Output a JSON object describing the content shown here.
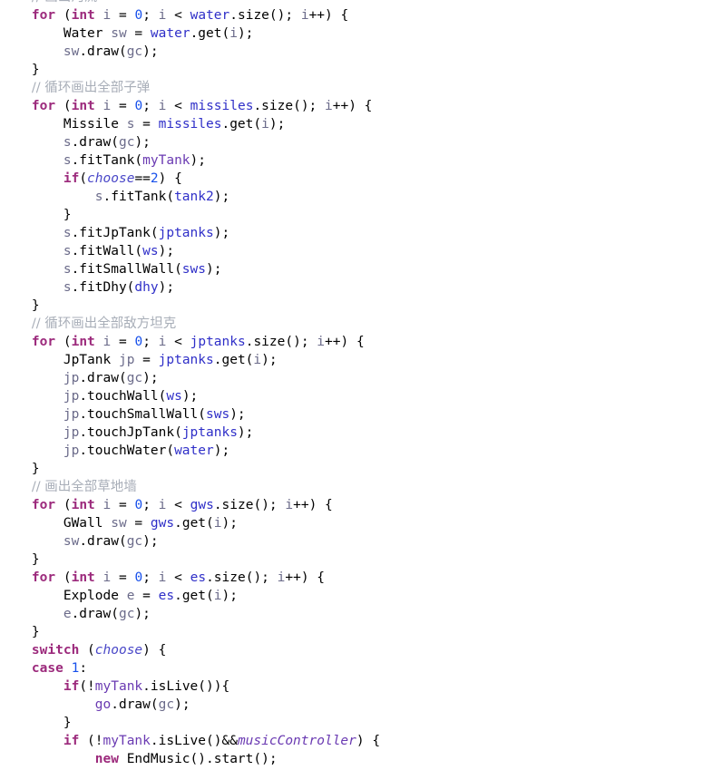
{
  "editor": {
    "language": "java",
    "background": "#ffffff",
    "font_size_px": 14.5,
    "line_height_px": 20,
    "gutter_visible": false,
    "first_line_clipped": true
  },
  "theme": {
    "default_text": "#000000",
    "keyword": "#9c2a7c",
    "comment": "#a8aeb8",
    "number": "#1750eb",
    "field": "#6a3ab2",
    "static_field": "#4a48c8",
    "reference": "#2f2fc8",
    "local_variable": "#6b6b8a",
    "background": "#ffffff"
  },
  "code": {
    "lines": [
      {
        "indent": "    ",
        "tokens": [
          {
            "t": "// 画出河流",
            "c": "comment",
            "cjk": true
          }
        ]
      },
      {
        "indent": "    ",
        "tokens": [
          {
            "t": "for",
            "c": "keyword"
          },
          {
            "t": " (",
            "c": "punc"
          },
          {
            "t": "int",
            "c": "keyword"
          },
          {
            "t": " ",
            "c": "plain"
          },
          {
            "t": "i",
            "c": "local"
          },
          {
            "t": " = ",
            "c": "punc"
          },
          {
            "t": "0",
            "c": "num"
          },
          {
            "t": "; ",
            "c": "punc"
          },
          {
            "t": "i",
            "c": "local"
          },
          {
            "t": " < ",
            "c": "punc"
          },
          {
            "t": "water",
            "c": "ref"
          },
          {
            "t": ".size(); ",
            "c": "punc"
          },
          {
            "t": "i",
            "c": "local"
          },
          {
            "t": "++) {",
            "c": "punc"
          }
        ]
      },
      {
        "indent": "        ",
        "tokens": [
          {
            "t": "Water",
            "c": "type"
          },
          {
            "t": " ",
            "c": "plain"
          },
          {
            "t": "sw",
            "c": "local"
          },
          {
            "t": " = ",
            "c": "punc"
          },
          {
            "t": "water",
            "c": "ref"
          },
          {
            "t": ".get(",
            "c": "punc"
          },
          {
            "t": "i",
            "c": "local"
          },
          {
            "t": ");",
            "c": "punc"
          }
        ]
      },
      {
        "indent": "        ",
        "tokens": [
          {
            "t": "sw",
            "c": "local"
          },
          {
            "t": ".draw(",
            "c": "punc"
          },
          {
            "t": "gc",
            "c": "local"
          },
          {
            "t": ");",
            "c": "punc"
          }
        ]
      },
      {
        "indent": "    ",
        "tokens": [
          {
            "t": "}",
            "c": "punc"
          }
        ]
      },
      {
        "indent": "    ",
        "tokens": [
          {
            "t": "// 循环画出全部子弹",
            "c": "comment",
            "cjk": true
          }
        ]
      },
      {
        "indent": "    ",
        "tokens": [
          {
            "t": "for",
            "c": "keyword"
          },
          {
            "t": " (",
            "c": "punc"
          },
          {
            "t": "int",
            "c": "keyword"
          },
          {
            "t": " ",
            "c": "plain"
          },
          {
            "t": "i",
            "c": "local"
          },
          {
            "t": " = ",
            "c": "punc"
          },
          {
            "t": "0",
            "c": "num"
          },
          {
            "t": "; ",
            "c": "punc"
          },
          {
            "t": "i",
            "c": "local"
          },
          {
            "t": " < ",
            "c": "punc"
          },
          {
            "t": "missiles",
            "c": "ref"
          },
          {
            "t": ".size(); ",
            "c": "punc"
          },
          {
            "t": "i",
            "c": "local"
          },
          {
            "t": "++) {",
            "c": "punc"
          }
        ]
      },
      {
        "indent": "        ",
        "tokens": [
          {
            "t": "Missile",
            "c": "type"
          },
          {
            "t": " ",
            "c": "plain"
          },
          {
            "t": "s",
            "c": "local"
          },
          {
            "t": " = ",
            "c": "punc"
          },
          {
            "t": "missiles",
            "c": "ref"
          },
          {
            "t": ".get(",
            "c": "punc"
          },
          {
            "t": "i",
            "c": "local"
          },
          {
            "t": ");",
            "c": "punc"
          }
        ]
      },
      {
        "indent": "        ",
        "tokens": [
          {
            "t": "s",
            "c": "local"
          },
          {
            "t": ".draw(",
            "c": "punc"
          },
          {
            "t": "gc",
            "c": "local"
          },
          {
            "t": ");",
            "c": "punc"
          }
        ]
      },
      {
        "indent": "        ",
        "tokens": [
          {
            "t": "s",
            "c": "local"
          },
          {
            "t": ".fitTank(",
            "c": "punc"
          },
          {
            "t": "myTank",
            "c": "field"
          },
          {
            "t": ");",
            "c": "punc"
          }
        ]
      },
      {
        "indent": "        ",
        "tokens": [
          {
            "t": "if",
            "c": "keyword"
          },
          {
            "t": "(",
            "c": "punc"
          },
          {
            "t": "choose",
            "c": "static"
          },
          {
            "t": "==",
            "c": "punc"
          },
          {
            "t": "2",
            "c": "num"
          },
          {
            "t": ") {",
            "c": "punc"
          }
        ]
      },
      {
        "indent": "            ",
        "tokens": [
          {
            "t": "s",
            "c": "local"
          },
          {
            "t": ".fitTank(",
            "c": "punc"
          },
          {
            "t": "tank2",
            "c": "ref"
          },
          {
            "t": ");",
            "c": "punc"
          }
        ]
      },
      {
        "indent": "        ",
        "tokens": [
          {
            "t": "}",
            "c": "punc"
          }
        ]
      },
      {
        "indent": "        ",
        "tokens": [
          {
            "t": "s",
            "c": "local"
          },
          {
            "t": ".fitJpTank(",
            "c": "punc"
          },
          {
            "t": "jptanks",
            "c": "ref"
          },
          {
            "t": ");",
            "c": "punc"
          }
        ]
      },
      {
        "indent": "        ",
        "tokens": [
          {
            "t": "s",
            "c": "local"
          },
          {
            "t": ".fitWall(",
            "c": "punc"
          },
          {
            "t": "ws",
            "c": "ref"
          },
          {
            "t": ");",
            "c": "punc"
          }
        ]
      },
      {
        "indent": "        ",
        "tokens": [
          {
            "t": "s",
            "c": "local"
          },
          {
            "t": ".fitSmallWall(",
            "c": "punc"
          },
          {
            "t": "sws",
            "c": "ref"
          },
          {
            "t": ");",
            "c": "punc"
          }
        ]
      },
      {
        "indent": "        ",
        "tokens": [
          {
            "t": "s",
            "c": "local"
          },
          {
            "t": ".fitDhy(",
            "c": "punc"
          },
          {
            "t": "dhy",
            "c": "ref"
          },
          {
            "t": ");",
            "c": "punc"
          }
        ]
      },
      {
        "indent": "    ",
        "tokens": [
          {
            "t": "}",
            "c": "punc"
          }
        ]
      },
      {
        "indent": "    ",
        "tokens": [
          {
            "t": "// 循环画出全部敌方坦克",
            "c": "comment",
            "cjk": true
          }
        ]
      },
      {
        "indent": "    ",
        "tokens": [
          {
            "t": "for",
            "c": "keyword"
          },
          {
            "t": " (",
            "c": "punc"
          },
          {
            "t": "int",
            "c": "keyword"
          },
          {
            "t": " ",
            "c": "plain"
          },
          {
            "t": "i",
            "c": "local"
          },
          {
            "t": " = ",
            "c": "punc"
          },
          {
            "t": "0",
            "c": "num"
          },
          {
            "t": "; ",
            "c": "punc"
          },
          {
            "t": "i",
            "c": "local"
          },
          {
            "t": " < ",
            "c": "punc"
          },
          {
            "t": "jptanks",
            "c": "ref"
          },
          {
            "t": ".size(); ",
            "c": "punc"
          },
          {
            "t": "i",
            "c": "local"
          },
          {
            "t": "++) {",
            "c": "punc"
          }
        ]
      },
      {
        "indent": "        ",
        "tokens": [
          {
            "t": "JpTank",
            "c": "type"
          },
          {
            "t": " ",
            "c": "plain"
          },
          {
            "t": "jp",
            "c": "local"
          },
          {
            "t": " = ",
            "c": "punc"
          },
          {
            "t": "jptanks",
            "c": "ref"
          },
          {
            "t": ".get(",
            "c": "punc"
          },
          {
            "t": "i",
            "c": "local"
          },
          {
            "t": ");",
            "c": "punc"
          }
        ]
      },
      {
        "indent": "        ",
        "tokens": [
          {
            "t": "jp",
            "c": "local"
          },
          {
            "t": ".draw(",
            "c": "punc"
          },
          {
            "t": "gc",
            "c": "local"
          },
          {
            "t": ");",
            "c": "punc"
          }
        ]
      },
      {
        "indent": "        ",
        "tokens": [
          {
            "t": "jp",
            "c": "local"
          },
          {
            "t": ".touchWall(",
            "c": "punc"
          },
          {
            "t": "ws",
            "c": "ref"
          },
          {
            "t": ");",
            "c": "punc"
          }
        ]
      },
      {
        "indent": "        ",
        "tokens": [
          {
            "t": "jp",
            "c": "local"
          },
          {
            "t": ".touchSmallWall(",
            "c": "punc"
          },
          {
            "t": "sws",
            "c": "ref"
          },
          {
            "t": ");",
            "c": "punc"
          }
        ]
      },
      {
        "indent": "        ",
        "tokens": [
          {
            "t": "jp",
            "c": "local"
          },
          {
            "t": ".touchJpTank(",
            "c": "punc"
          },
          {
            "t": "jptanks",
            "c": "ref"
          },
          {
            "t": ");",
            "c": "punc"
          }
        ]
      },
      {
        "indent": "        ",
        "tokens": [
          {
            "t": "jp",
            "c": "local"
          },
          {
            "t": ".touchWater(",
            "c": "punc"
          },
          {
            "t": "water",
            "c": "ref"
          },
          {
            "t": ");",
            "c": "punc"
          }
        ]
      },
      {
        "indent": "    ",
        "tokens": [
          {
            "t": "}",
            "c": "punc"
          }
        ]
      },
      {
        "indent": "    ",
        "tokens": [
          {
            "t": "// 画出全部草地墙",
            "c": "comment",
            "cjk": true
          }
        ]
      },
      {
        "indent": "    ",
        "tokens": [
          {
            "t": "for",
            "c": "keyword"
          },
          {
            "t": " (",
            "c": "punc"
          },
          {
            "t": "int",
            "c": "keyword"
          },
          {
            "t": " ",
            "c": "plain"
          },
          {
            "t": "i",
            "c": "local"
          },
          {
            "t": " = ",
            "c": "punc"
          },
          {
            "t": "0",
            "c": "num"
          },
          {
            "t": "; ",
            "c": "punc"
          },
          {
            "t": "i",
            "c": "local"
          },
          {
            "t": " < ",
            "c": "punc"
          },
          {
            "t": "gws",
            "c": "ref"
          },
          {
            "t": ".size(); ",
            "c": "punc"
          },
          {
            "t": "i",
            "c": "local"
          },
          {
            "t": "++) {",
            "c": "punc"
          }
        ]
      },
      {
        "indent": "        ",
        "tokens": [
          {
            "t": "GWall",
            "c": "type"
          },
          {
            "t": " ",
            "c": "plain"
          },
          {
            "t": "sw",
            "c": "local"
          },
          {
            "t": " = ",
            "c": "punc"
          },
          {
            "t": "gws",
            "c": "ref"
          },
          {
            "t": ".get(",
            "c": "punc"
          },
          {
            "t": "i",
            "c": "local"
          },
          {
            "t": ");",
            "c": "punc"
          }
        ]
      },
      {
        "indent": "        ",
        "tokens": [
          {
            "t": "sw",
            "c": "local"
          },
          {
            "t": ".draw(",
            "c": "punc"
          },
          {
            "t": "gc",
            "c": "local"
          },
          {
            "t": ");",
            "c": "punc"
          }
        ]
      },
      {
        "indent": "    ",
        "tokens": [
          {
            "t": "}",
            "c": "punc"
          }
        ]
      },
      {
        "indent": "    ",
        "tokens": [
          {
            "t": "for",
            "c": "keyword"
          },
          {
            "t": " (",
            "c": "punc"
          },
          {
            "t": "int",
            "c": "keyword"
          },
          {
            "t": " ",
            "c": "plain"
          },
          {
            "t": "i",
            "c": "local"
          },
          {
            "t": " = ",
            "c": "punc"
          },
          {
            "t": "0",
            "c": "num"
          },
          {
            "t": "; ",
            "c": "punc"
          },
          {
            "t": "i",
            "c": "local"
          },
          {
            "t": " < ",
            "c": "punc"
          },
          {
            "t": "es",
            "c": "ref"
          },
          {
            "t": ".size(); ",
            "c": "punc"
          },
          {
            "t": "i",
            "c": "local"
          },
          {
            "t": "++) {",
            "c": "punc"
          }
        ]
      },
      {
        "indent": "        ",
        "tokens": [
          {
            "t": "Explode",
            "c": "type"
          },
          {
            "t": " ",
            "c": "plain"
          },
          {
            "t": "e",
            "c": "local"
          },
          {
            "t": " = ",
            "c": "punc"
          },
          {
            "t": "es",
            "c": "ref"
          },
          {
            "t": ".get(",
            "c": "punc"
          },
          {
            "t": "i",
            "c": "local"
          },
          {
            "t": ");",
            "c": "punc"
          }
        ]
      },
      {
        "indent": "        ",
        "tokens": [
          {
            "t": "e",
            "c": "local"
          },
          {
            "t": ".draw(",
            "c": "punc"
          },
          {
            "t": "gc",
            "c": "local"
          },
          {
            "t": ");",
            "c": "punc"
          }
        ]
      },
      {
        "indent": "    ",
        "tokens": [
          {
            "t": "}",
            "c": "punc"
          }
        ]
      },
      {
        "indent": "    ",
        "tokens": [
          {
            "t": "switch",
            "c": "keyword"
          },
          {
            "t": " (",
            "c": "punc"
          },
          {
            "t": "choose",
            "c": "static"
          },
          {
            "t": ") {",
            "c": "punc"
          }
        ]
      },
      {
        "indent": "    ",
        "tokens": [
          {
            "t": "case",
            "c": "keyword"
          },
          {
            "t": " ",
            "c": "plain"
          },
          {
            "t": "1",
            "c": "num"
          },
          {
            "t": ":",
            "c": "punc"
          }
        ]
      },
      {
        "indent": "        ",
        "tokens": [
          {
            "t": "if",
            "c": "keyword"
          },
          {
            "t": "(!",
            "c": "punc"
          },
          {
            "t": "myTank",
            "c": "field"
          },
          {
            "t": ".isLive()){",
            "c": "punc"
          }
        ]
      },
      {
        "indent": "            ",
        "tokens": [
          {
            "t": "go",
            "c": "field"
          },
          {
            "t": ".draw(",
            "c": "punc"
          },
          {
            "t": "gc",
            "c": "local"
          },
          {
            "t": ");",
            "c": "punc"
          }
        ]
      },
      {
        "indent": "        ",
        "tokens": [
          {
            "t": "}",
            "c": "punc"
          }
        ]
      },
      {
        "indent": "        ",
        "tokens": [
          {
            "t": "if",
            "c": "keyword"
          },
          {
            "t": " (!",
            "c": "punc"
          },
          {
            "t": "myTank",
            "c": "field"
          },
          {
            "t": ".isLive()&&",
            "c": "punc"
          },
          {
            "t": "musicController",
            "c": "staticf"
          },
          {
            "t": ") {",
            "c": "punc"
          }
        ]
      },
      {
        "indent": "            ",
        "tokens": [
          {
            "t": "new",
            "c": "keyword"
          },
          {
            "t": " ",
            "c": "plain"
          },
          {
            "t": "EndMusic",
            "c": "type"
          },
          {
            "t": "().start();",
            "c": "punc"
          }
        ]
      }
    ]
  }
}
